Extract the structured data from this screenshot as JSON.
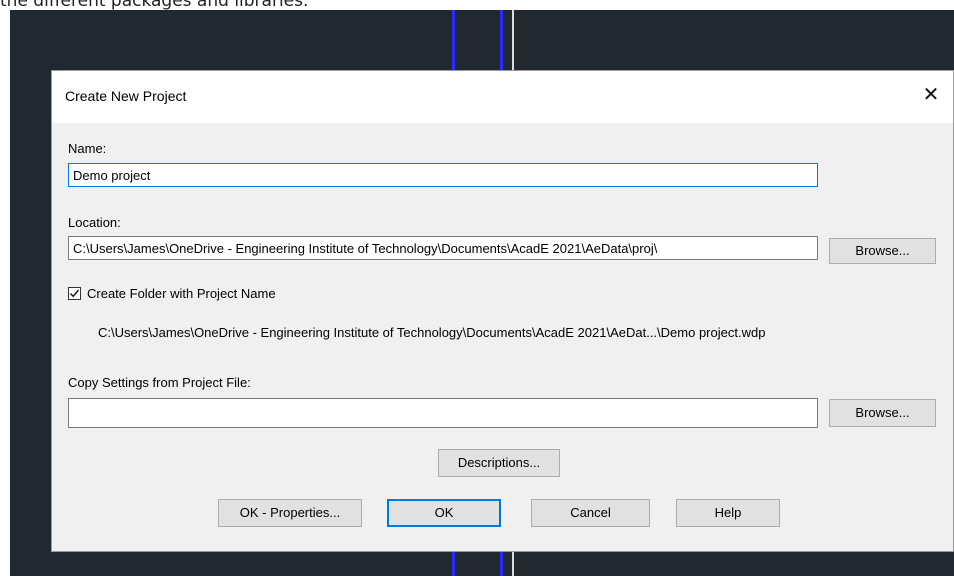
{
  "page_caption": "the different packages and libraries.",
  "dialog": {
    "title": "Create New Project",
    "name_label": "Name:",
    "name_value": "Demo project",
    "location_label": "Location:",
    "location_value": "C:\\Users\\James\\OneDrive - Engineering Institute of Technology\\Documents\\AcadE 2021\\AeData\\proj\\",
    "browse_label": "Browse...",
    "create_folder_label": "Create Folder with Project Name",
    "create_folder_checked": true,
    "project_path": "C:\\Users\\James\\OneDrive - Engineering Institute of Technology\\Documents\\AcadE 2021\\AeDat...\\Demo project.wdp",
    "copy_settings_label": "Copy Settings from Project File:",
    "copy_settings_value": "",
    "descriptions_label": "Descriptions...",
    "ok_properties_label": "OK - Properties...",
    "ok_label": "OK",
    "cancel_label": "Cancel",
    "help_label": "Help"
  },
  "icons": {
    "close": "close-icon",
    "check": "checkmark-icon"
  },
  "colors": {
    "background": "#212830",
    "guide_line": "#2a2aff",
    "accent": "#0078d7"
  }
}
